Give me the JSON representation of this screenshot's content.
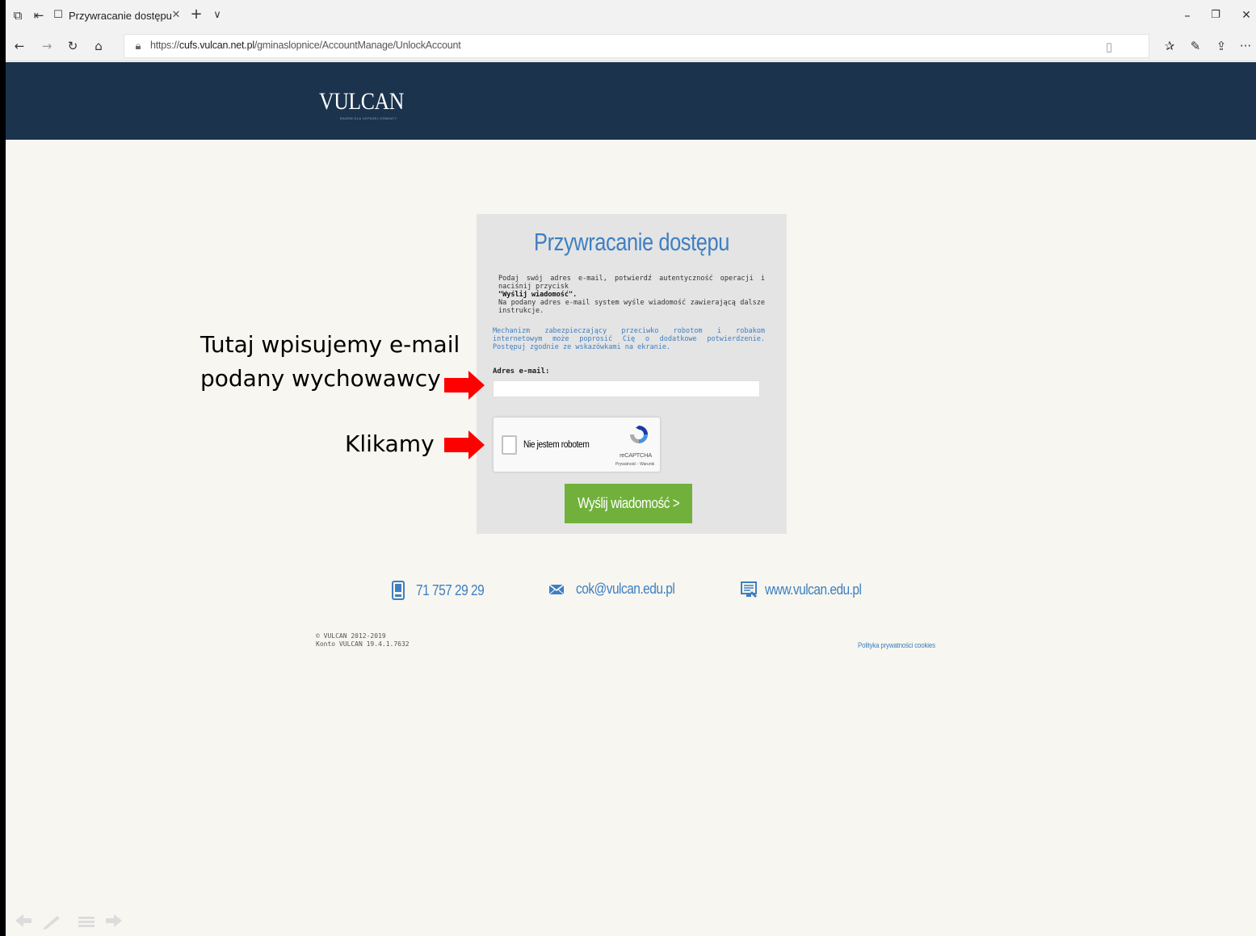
{
  "browser": {
    "tab_title": "Przywracanie dostępu",
    "url_prefix": "https://",
    "url_host": "cufs.vulcan.net.pl",
    "url_path": "/gminaslopnice/AccountManage/UnlockAccount"
  },
  "header": {
    "logo": "VULCAN",
    "logo_tagline": "RAZEM DLA LEPSZEJ OŚWIATY",
    "background": "#1b334d"
  },
  "panel": {
    "title": "Przywracanie dostępu",
    "desc_line1": "Podaj swój adres e-mail, potwierdź autentyczność operacji i naciśnij przycisk",
    "desc_bold": "\"Wyślij wiadomość\".",
    "desc_line2": "Na podany adres e-mail system wyśle wiadomość zawierającą dalsze instrukcje.",
    "note": "Mechanizm zabezpieczający przeciwko robotom i robakom internetowym może poprosić Cię o dodatkowe potwierdzenie. Postępuj zgodnie ze wskazówkami na ekranie.",
    "email_label": "Adres e-mail:",
    "email_value": "",
    "captcha_label": "Nie jestem robotem",
    "captcha_brand": "reCAPTCHA",
    "captcha_links": "Prywatność - Warunki",
    "send_label": "Wyślij wiadomość >",
    "accent": "#3e7fc1",
    "button_color": "#71b13b"
  },
  "contacts": {
    "phone": "71 757 29 29",
    "email": "cok@vulcan.edu.pl",
    "website": "www.vulcan.edu.pl"
  },
  "footer": {
    "copyright": "© VULCAN 2012-2019",
    "version": "Konto VULCAN 19.4.1.7632",
    "cookie_policy": "Polityka prywatności cookies"
  },
  "annotations": {
    "email_hint_line1": "Tutaj wpisujemy e-mail",
    "email_hint_line2": "podany wychowawcy",
    "click_hint": "Klikamy",
    "arrow_color": "#ff0000"
  }
}
